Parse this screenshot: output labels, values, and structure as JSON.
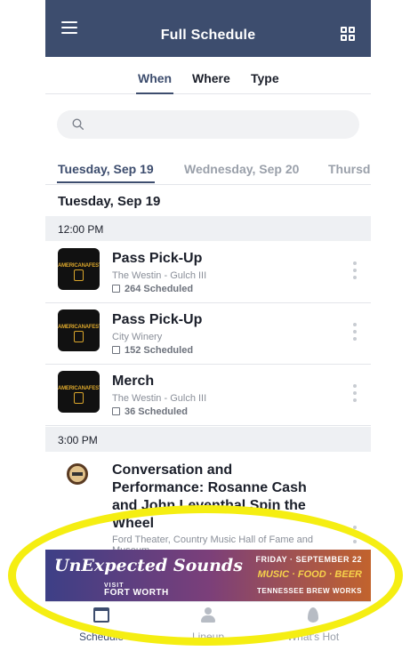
{
  "appbar": {
    "title": "Full Schedule",
    "menu_icon": "hamburger-menu-icon",
    "grid_icon": "grid-view-icon",
    "background": "#3d4d6e"
  },
  "filters": {
    "when": "When",
    "where": "Where",
    "type": "Type",
    "active": "When"
  },
  "search": {
    "placeholder": "",
    "value": ""
  },
  "date_tabs": [
    {
      "label": "Tuesday, Sep 19",
      "active": true
    },
    {
      "label": "Wednesday, Sep 20",
      "active": false
    },
    {
      "label": "Thursd",
      "active": false
    }
  ],
  "day_heading": "Tuesday, Sep 19",
  "time_groups": [
    {
      "time": "12:00 PM",
      "events": [
        {
          "name": "Pass Pick-Up",
          "location": "The Westin - Gulch III",
          "scheduled": "264 Scheduled",
          "logo_text": "AMERICANAFEST"
        },
        {
          "name": "Pass Pick-Up",
          "location": "City Winery",
          "scheduled": "152 Scheduled",
          "logo_text": "AMERICANAFEST"
        },
        {
          "name": "Merch",
          "location": "The Westin - Gulch III",
          "scheduled": "36 Scheduled",
          "logo_text": "AMERICANAFEST"
        }
      ]
    },
    {
      "time": "3:00 PM",
      "events": [
        {
          "name": "Conversation and Performance: Rosanne Cash and John Leventhal Spin the Wheel",
          "location": "Ford Theater, Country Music Hall of Fame and Museum"
        }
      ]
    }
  ],
  "ad": {
    "headline": "UnExpected Sounds",
    "visit_small": "VISIT",
    "visit_big": "FORT WORTH",
    "date": "FRIDAY · SEPTEMBER 22",
    "tagline": "MUSIC · FOOD · BEER",
    "sponsor": "TENNESSEE BREW WORKS"
  },
  "bottom_nav": [
    {
      "label": "Schedule",
      "icon": "calendar-icon",
      "active": true
    },
    {
      "label": "Lineup",
      "icon": "people-icon",
      "active": false
    },
    {
      "label": "What's Hot",
      "icon": "flame-icon",
      "active": false
    }
  ],
  "colors": {
    "primary": "#3d4d6e",
    "highlight": "#f5ee12",
    "logo_gold": "#d9a52b"
  }
}
